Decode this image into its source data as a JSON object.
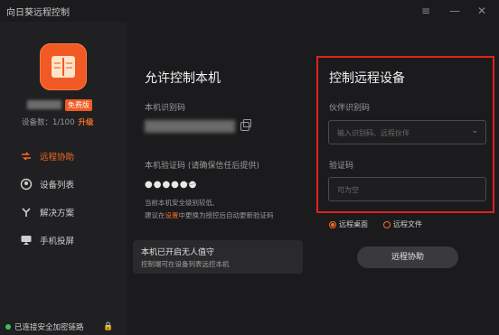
{
  "app": {
    "title": "向日葵远程控制"
  },
  "titlebar": {
    "menu_icon": "menu-icon",
    "minimize_icon": "minimize-icon",
    "close_icon": "close-icon"
  },
  "sidebar": {
    "badge": "免费版",
    "device_count": "设备数：1/100",
    "upgrade": "升级",
    "items": [
      {
        "label": "远程协助",
        "icon": "remote-assist-icon",
        "active": true
      },
      {
        "label": "设备列表",
        "icon": "device-list-icon",
        "active": false
      },
      {
        "label": "解决方案",
        "icon": "solution-icon",
        "active": false
      },
      {
        "label": "手机投屏",
        "icon": "screen-cast-icon",
        "active": false
      }
    ],
    "status": "已连接安全加密链路"
  },
  "allow": {
    "title": "允许控制本机",
    "id_label": "本机识别码",
    "code_label": "本机验证码 (请确保信任后提供)",
    "code_value": "●●●●●●",
    "note_line1": "当前本机安全级别较低,",
    "note_line2_prefix": "建议在",
    "note_line2_link": "设置",
    "note_line2_suffix": "中更换为授控后自动更新验证码",
    "notice_title": "本机已开启无人值守",
    "notice_sub": "控制端可在设备列表远控本机"
  },
  "control": {
    "title": "控制远程设备",
    "partner_label": "伙伴识别码",
    "partner_placeholder": "输入识别码、远程伙伴",
    "verify_label": "验证码",
    "verify_placeholder": "可为空",
    "radio_desktop": "远程桌面",
    "radio_file": "远程文件",
    "connect_button": "远程协助"
  },
  "colors": {
    "accent": "#f36b21",
    "highlight_box": "#e0231c",
    "status_ok": "#3ac35b"
  }
}
